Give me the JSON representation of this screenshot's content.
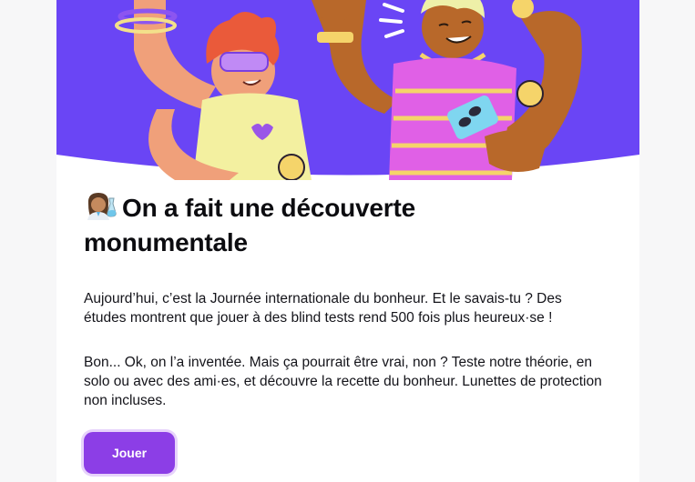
{
  "email": {
    "title_line1": "On a fait une découverte",
    "title_line2": "monumentale",
    "paragraph1": "Aujourd’hui, c’est la Journée internationale du bonheur. Et le savais-tu ? Des études montrent que jouer à des blind tests rend 500 fois plus heureux·se !",
    "paragraph2": "Bon... Ok, on l’a inventée. Mais ça pourrait être vrai, non ? Teste notre théorie, en solo ou avec des ami·es, et découvre la recette du bonheur. Lunettes de protection non incluses.",
    "cta_label": "Jouer",
    "title_emoji": "scientist-emoji"
  },
  "colors": {
    "hero_background": "#6a45f5",
    "button": "#8c3ee6",
    "text": "#14141a"
  }
}
